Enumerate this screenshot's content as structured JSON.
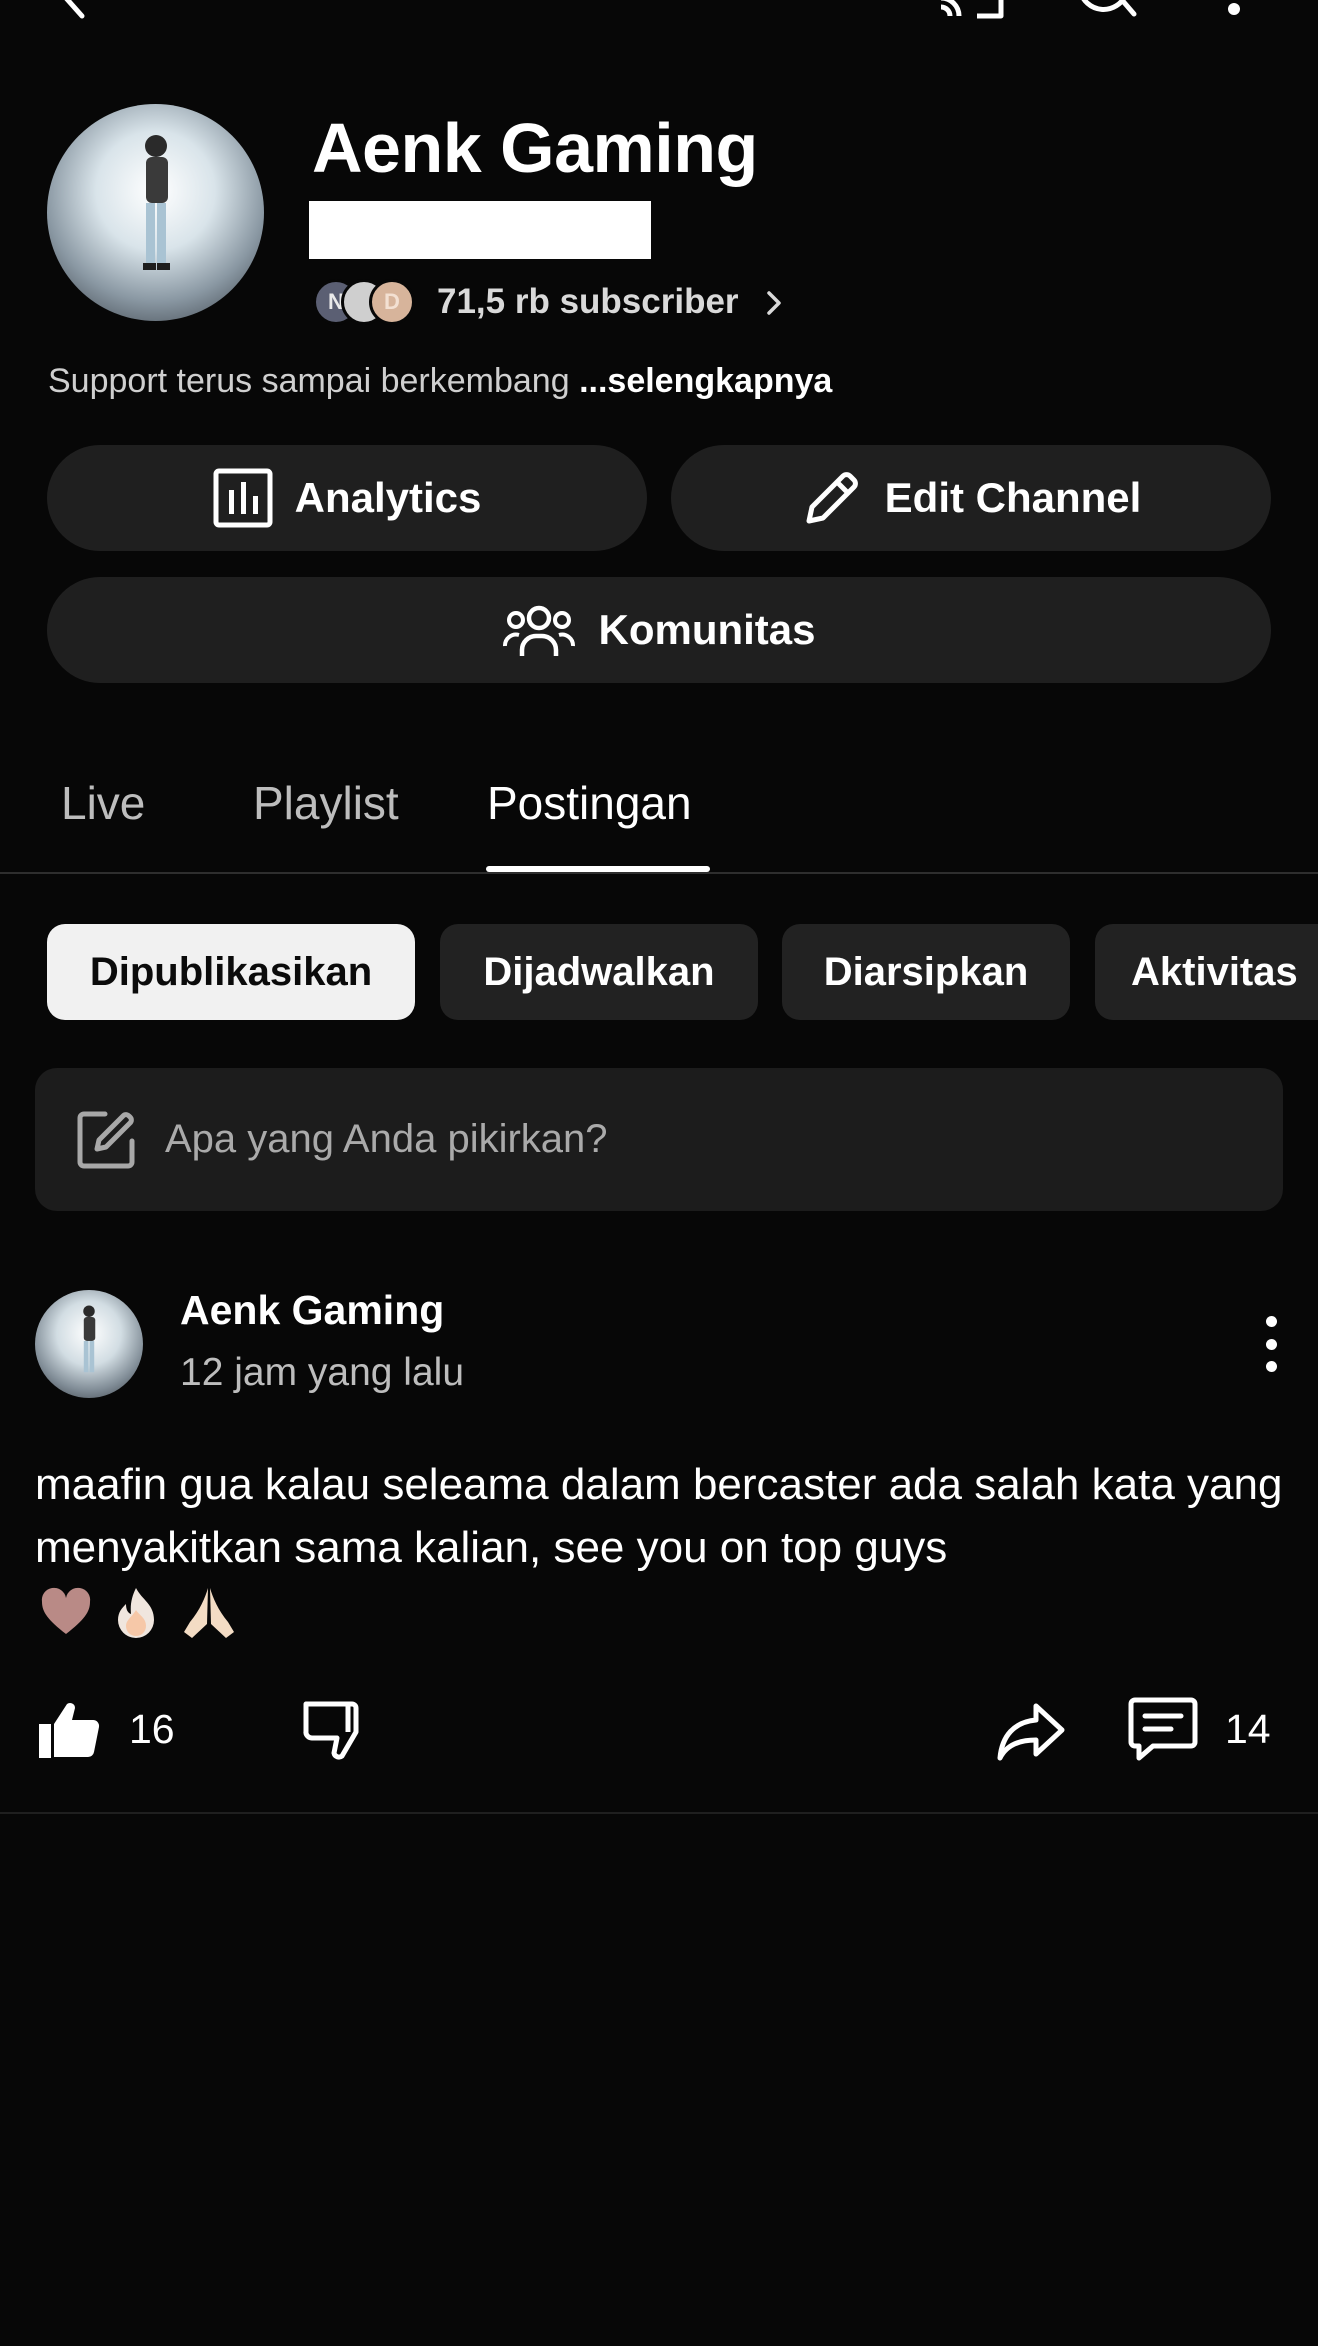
{
  "top_bar": {
    "icons": [
      "back-arrow-icon",
      "cast-icon",
      "search-icon",
      "more-vertical-icon"
    ]
  },
  "channel": {
    "name": "Aenk Gaming",
    "subscriber_avatars": [
      "N",
      "",
      "D"
    ],
    "subscribers": "71,5 rb subscriber",
    "description": "Support terus sampai berkembang",
    "more_label": "...selengkapnya"
  },
  "actions": {
    "analytics_label": "Analytics",
    "edit_label": "Edit Channel",
    "community_label": "Komunitas"
  },
  "tabs": [
    {
      "label": "Live",
      "active": false
    },
    {
      "label": "Playlist",
      "active": false
    },
    {
      "label": "Postingan",
      "active": true
    }
  ],
  "chips": [
    {
      "label": "Dipublikasikan",
      "active": true
    },
    {
      "label": "Dijadwalkan",
      "active": false
    },
    {
      "label": "Diarsipkan",
      "active": false
    },
    {
      "label": "Aktivitas",
      "active": false
    }
  ],
  "composer": {
    "placeholder": "Apa yang Anda pikirkan?"
  },
  "post": {
    "author": "Aenk Gaming",
    "time": "12 jam yang lalu",
    "text": "maafin gua kalau seleama dalam bercaster ada salah kata yang menyakitkan sama kalian, see you on top guys",
    "emojis": [
      "🤎",
      "🔥",
      "🙏🏻"
    ],
    "likes": "16",
    "comments": "14"
  },
  "colors": {
    "background": "#070707",
    "surface": "#1f1f1f",
    "active_chip": "#f1f1f1",
    "text": "#ffffff",
    "muted_text": "#bdbdbd"
  }
}
